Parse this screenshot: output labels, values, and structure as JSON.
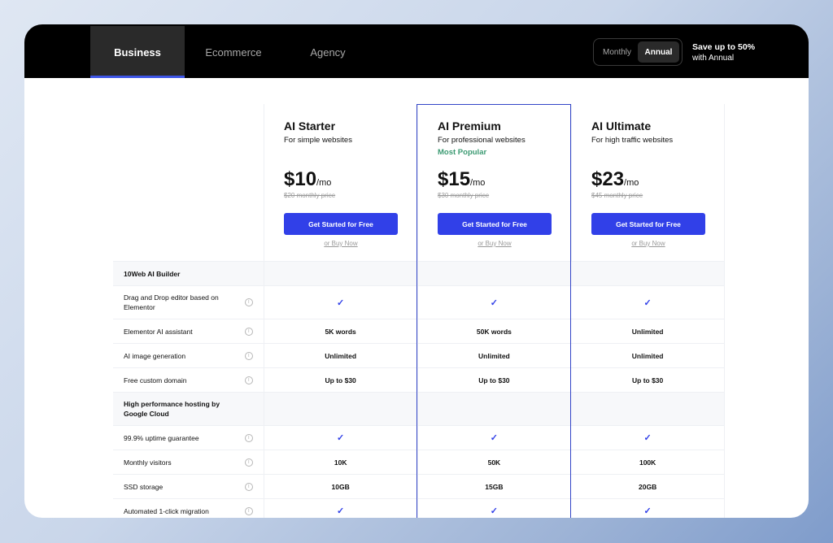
{
  "tabs": [
    {
      "label": "Business",
      "active": true
    },
    {
      "label": "Ecommerce",
      "active": false
    },
    {
      "label": "Agency",
      "active": false
    }
  ],
  "billing_toggle": {
    "monthly": "Monthly",
    "annual": "Annual",
    "selected": "Annual"
  },
  "promo": {
    "headline": "Save up to 50%",
    "subline": "with Annual"
  },
  "plans": [
    {
      "name": "AI Starter",
      "subtitle": "For simple websites",
      "badge": "",
      "price": "$10",
      "period": "/mo",
      "old_price": "$20 monthly price",
      "cta": "Get Started for Free",
      "buy_link": "or Buy Now"
    },
    {
      "name": "AI Premium",
      "subtitle": "For professional websites",
      "badge": "Most Popular",
      "price": "$15",
      "period": "/mo",
      "old_price": "$30 monthly price",
      "cta": "Get Started for Free",
      "buy_link": "or Buy Now"
    },
    {
      "name": "AI Ultimate",
      "subtitle": "For high traffic websites",
      "badge": "",
      "price": "$23",
      "period": "/mo",
      "old_price": "$45 monthly price",
      "cta": "Get Started for Free",
      "buy_link": "or Buy Now"
    }
  ],
  "features": [
    {
      "label": "10Web AI Builder",
      "section": true,
      "values": [
        "",
        "",
        ""
      ]
    },
    {
      "label": "Drag and Drop editor based on Elementor",
      "section": false,
      "info": true,
      "values": [
        "✓",
        "✓",
        "✓"
      ]
    },
    {
      "label": "Elementor AI assistant",
      "section": false,
      "info": true,
      "values": [
        "5K words",
        "50K words",
        "Unlimited"
      ]
    },
    {
      "label": "AI image generation",
      "section": false,
      "info": true,
      "values": [
        "Unlimited",
        "Unlimited",
        "Unlimited"
      ]
    },
    {
      "label": "Free custom domain",
      "section": false,
      "info": true,
      "values": [
        "Up to $30",
        "Up to $30",
        "Up to $30"
      ]
    },
    {
      "label": "High performance hosting by Google Cloud",
      "section": true,
      "values": [
        "",
        "",
        ""
      ]
    },
    {
      "label": "99.9% uptime guarantee",
      "section": false,
      "info": true,
      "values": [
        "✓",
        "✓",
        "✓"
      ]
    },
    {
      "label": "Monthly visitors",
      "section": false,
      "info": true,
      "values": [
        "10K",
        "50K",
        "100K"
      ]
    },
    {
      "label": "SSD storage",
      "section": false,
      "info": true,
      "values": [
        "10GB",
        "15GB",
        "20GB"
      ]
    },
    {
      "label": "Automated 1-click migration",
      "section": false,
      "info": true,
      "values": [
        "✓",
        "✓",
        "✓"
      ]
    }
  ],
  "colors": {
    "accent": "#3140e8",
    "popular": "#3b9a72",
    "topbar": "#000000"
  }
}
